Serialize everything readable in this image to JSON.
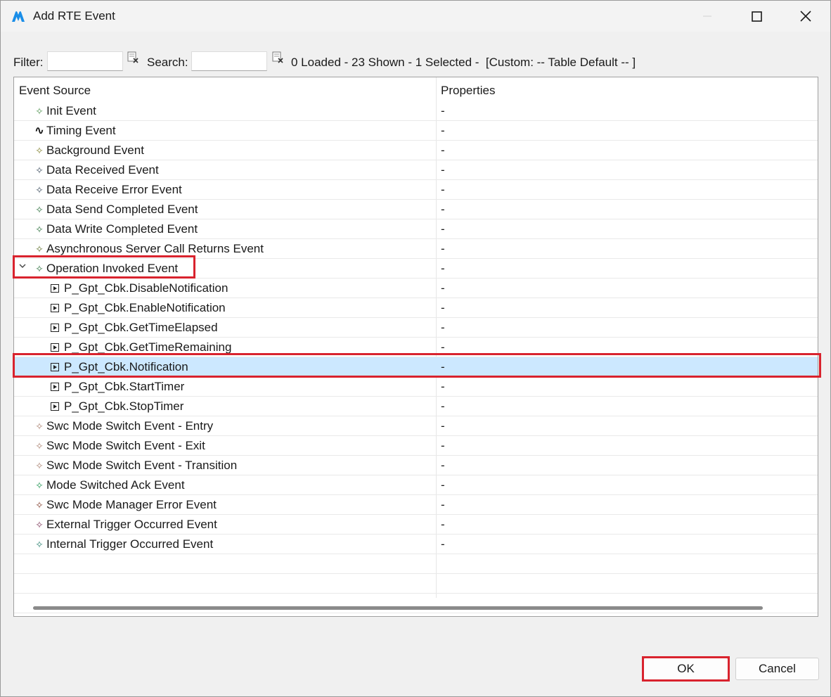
{
  "window": {
    "title": "Add RTE Event",
    "brand_color": "#1a8ee8"
  },
  "toolbar": {
    "filter_label": "Filter:",
    "filter_value": "",
    "search_label": "Search:",
    "search_value": "",
    "status": "0 Loaded - 23 Shown - 1 Selected -  [Custom: -- Table Default -- ]"
  },
  "table": {
    "columns": [
      "Event Source",
      "Properties"
    ],
    "rows": [
      {
        "label": "Init Event",
        "props": "-",
        "level": 0,
        "icon": "star-icon",
        "icon_color": "#5a9a5a"
      },
      {
        "label": "Timing Event",
        "props": "-",
        "level": 0,
        "icon": "timing-wave-icon",
        "icon_color": "#111111"
      },
      {
        "label": "Background Event",
        "props": "-",
        "level": 0,
        "icon": "star-icon",
        "icon_color": "#8a8a3a"
      },
      {
        "label": "Data Received Event",
        "props": "-",
        "level": 0,
        "icon": "star-icon",
        "icon_color": "#4a5a6a"
      },
      {
        "label": "Data Receive Error Event",
        "props": "-",
        "level": 0,
        "icon": "star-icon",
        "icon_color": "#4a5a6a"
      },
      {
        "label": "Data Send Completed Event",
        "props": "-",
        "level": 0,
        "icon": "star-icon",
        "icon_color": "#3a7a4a"
      },
      {
        "label": "Data Write Completed Event",
        "props": "-",
        "level": 0,
        "icon": "star-icon",
        "icon_color": "#3a7a4a"
      },
      {
        "label": "Asynchronous Server Call Returns Event",
        "props": "-",
        "level": 0,
        "icon": "star-icon",
        "icon_color": "#6a7a3a"
      },
      {
        "label": "Operation Invoked Event",
        "props": "-",
        "level": 0,
        "icon": "star-icon",
        "icon_color": "#3a7a4a",
        "expanded": true
      },
      {
        "label": "P_Gpt_Cbk.DisableNotification",
        "props": "-",
        "level": 1,
        "icon": "operation-icon"
      },
      {
        "label": "P_Gpt_Cbk.EnableNotification",
        "props": "-",
        "level": 1,
        "icon": "operation-icon"
      },
      {
        "label": "P_Gpt_Cbk.GetTimeElapsed",
        "props": "-",
        "level": 1,
        "icon": "operation-icon"
      },
      {
        "label": "P_Gpt_Cbk.GetTimeRemaining",
        "props": "-",
        "level": 1,
        "icon": "operation-icon"
      },
      {
        "label": "P_Gpt_Cbk.Notification",
        "props": "-",
        "level": 1,
        "icon": "operation-icon",
        "selected": true
      },
      {
        "label": "P_Gpt_Cbk.StartTimer",
        "props": "-",
        "level": 1,
        "icon": "operation-icon"
      },
      {
        "label": "P_Gpt_Cbk.StopTimer",
        "props": "-",
        "level": 1,
        "icon": "operation-icon"
      },
      {
        "label": "Swc Mode Switch Event - Entry",
        "props": "-",
        "level": 0,
        "icon": "star-icon",
        "icon_color": "#b08a7a"
      },
      {
        "label": "Swc Mode Switch Event - Exit",
        "props": "-",
        "level": 0,
        "icon": "star-icon",
        "icon_color": "#b08a7a"
      },
      {
        "label": "Swc Mode Switch Event - Transition",
        "props": "-",
        "level": 0,
        "icon": "star-icon",
        "icon_color": "#b08a7a"
      },
      {
        "label": "Mode Switched Ack Event",
        "props": "-",
        "level": 0,
        "icon": "star-icon",
        "icon_color": "#2a9a5a"
      },
      {
        "label": "Swc Mode Manager Error Event",
        "props": "-",
        "level": 0,
        "icon": "star-icon",
        "icon_color": "#8a4a3a"
      },
      {
        "label": "External Trigger Occurred Event",
        "props": "-",
        "level": 0,
        "icon": "star-icon",
        "icon_color": "#8a4a6a"
      },
      {
        "label": "Internal Trigger Occurred Event",
        "props": "-",
        "level": 0,
        "icon": "star-icon",
        "icon_color": "#3a8a7a"
      }
    ]
  },
  "buttons": {
    "ok": "OK",
    "cancel": "Cancel"
  },
  "highlight_color": "#d9232e"
}
